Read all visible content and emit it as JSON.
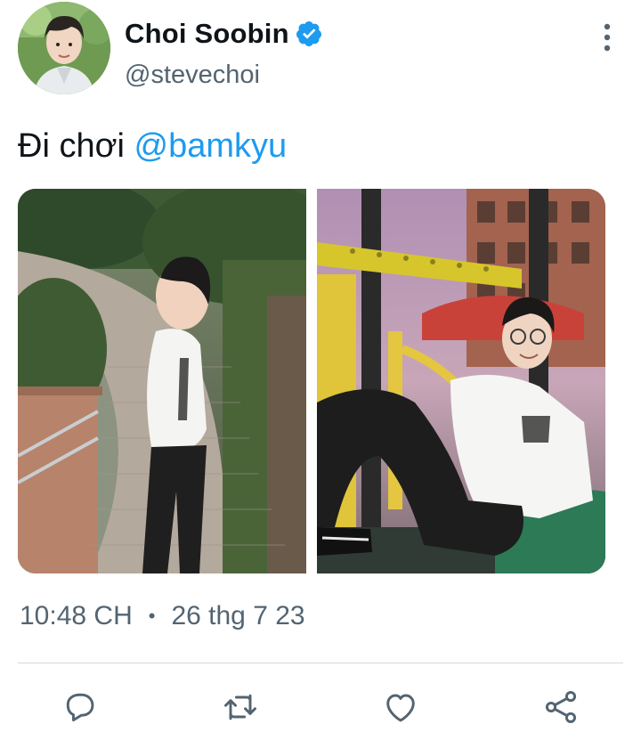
{
  "tweet": {
    "author": {
      "display_name": "Choi Soobin",
      "handle": "@stevechoi",
      "verified": true,
      "avatar_icon": "avatar-photo"
    },
    "text_prefix": "Đi chơi",
    "mention": "@bamkyu",
    "media": [
      {
        "label": "photo-walkway-standing"
      },
      {
        "label": "photo-playground-sitting"
      }
    ],
    "time": "10:48 CH",
    "separator": "•",
    "date": "26 thg 7 23"
  },
  "actions": [
    {
      "icon": "reply-icon"
    },
    {
      "icon": "retweet-icon"
    },
    {
      "icon": "like-icon"
    },
    {
      "icon": "share-icon"
    }
  ],
  "colors": {
    "accent": "#1d9bf0",
    "secondary_text": "#536471",
    "divider": "#cfd9de",
    "primary_text": "#0f1419"
  }
}
